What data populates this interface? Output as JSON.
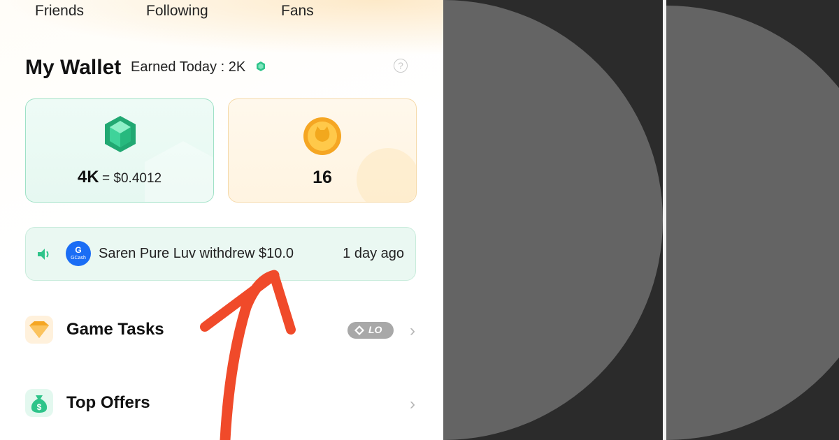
{
  "tabs": [
    "Friends",
    "Following",
    "Fans"
  ],
  "wallet": {
    "title": "My Wallet",
    "earned_today": "Earned Today : 2K",
    "help": "?"
  },
  "balances": {
    "gems": "4K",
    "gems_equals": "= $0.4012",
    "coins": "16"
  },
  "ticker": {
    "app_logo": "G",
    "app_name": "GCash",
    "message": "Saren Pure Luv withdrew $10.0",
    "time": "1 day ago"
  },
  "menu": {
    "game_tasks": "Game Tasks",
    "game_tasks_badge": "LO",
    "top_offers": "Top Offers",
    "chevron": "›"
  },
  "colors": {
    "gem_green": "#2ec48a",
    "coin_orange": "#f5a623",
    "arrow_red": "#f04a2a",
    "gcash_blue": "#1a6df5"
  },
  "icons": [
    "speaker-icon",
    "gem-icon",
    "coin-icon",
    "diamond-icon",
    "money-bag-icon",
    "help-icon"
  ]
}
